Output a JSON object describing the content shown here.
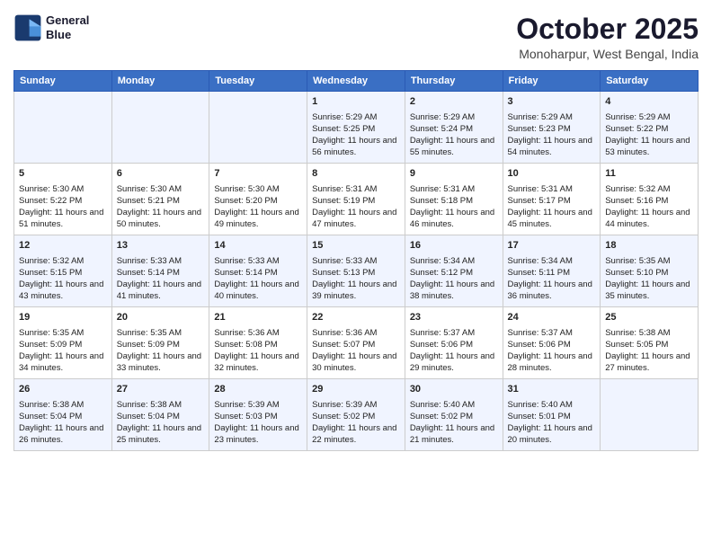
{
  "header": {
    "logo_line1": "General",
    "logo_line2": "Blue",
    "month_title": "October 2025",
    "subtitle": "Monoharpur, West Bengal, India"
  },
  "weekdays": [
    "Sunday",
    "Monday",
    "Tuesday",
    "Wednesday",
    "Thursday",
    "Friday",
    "Saturday"
  ],
  "weeks": [
    [
      {
        "day": "",
        "sunrise": "",
        "sunset": "",
        "daylight": ""
      },
      {
        "day": "",
        "sunrise": "",
        "sunset": "",
        "daylight": ""
      },
      {
        "day": "",
        "sunrise": "",
        "sunset": "",
        "daylight": ""
      },
      {
        "day": "1",
        "sunrise": "Sunrise: 5:29 AM",
        "sunset": "Sunset: 5:25 PM",
        "daylight": "Daylight: 11 hours and 56 minutes."
      },
      {
        "day": "2",
        "sunrise": "Sunrise: 5:29 AM",
        "sunset": "Sunset: 5:24 PM",
        "daylight": "Daylight: 11 hours and 55 minutes."
      },
      {
        "day": "3",
        "sunrise": "Sunrise: 5:29 AM",
        "sunset": "Sunset: 5:23 PM",
        "daylight": "Daylight: 11 hours and 54 minutes."
      },
      {
        "day": "4",
        "sunrise": "Sunrise: 5:29 AM",
        "sunset": "Sunset: 5:22 PM",
        "daylight": "Daylight: 11 hours and 53 minutes."
      }
    ],
    [
      {
        "day": "5",
        "sunrise": "Sunrise: 5:30 AM",
        "sunset": "Sunset: 5:22 PM",
        "daylight": "Daylight: 11 hours and 51 minutes."
      },
      {
        "day": "6",
        "sunrise": "Sunrise: 5:30 AM",
        "sunset": "Sunset: 5:21 PM",
        "daylight": "Daylight: 11 hours and 50 minutes."
      },
      {
        "day": "7",
        "sunrise": "Sunrise: 5:30 AM",
        "sunset": "Sunset: 5:20 PM",
        "daylight": "Daylight: 11 hours and 49 minutes."
      },
      {
        "day": "8",
        "sunrise": "Sunrise: 5:31 AM",
        "sunset": "Sunset: 5:19 PM",
        "daylight": "Daylight: 11 hours and 47 minutes."
      },
      {
        "day": "9",
        "sunrise": "Sunrise: 5:31 AM",
        "sunset": "Sunset: 5:18 PM",
        "daylight": "Daylight: 11 hours and 46 minutes."
      },
      {
        "day": "10",
        "sunrise": "Sunrise: 5:31 AM",
        "sunset": "Sunset: 5:17 PM",
        "daylight": "Daylight: 11 hours and 45 minutes."
      },
      {
        "day": "11",
        "sunrise": "Sunrise: 5:32 AM",
        "sunset": "Sunset: 5:16 PM",
        "daylight": "Daylight: 11 hours and 44 minutes."
      }
    ],
    [
      {
        "day": "12",
        "sunrise": "Sunrise: 5:32 AM",
        "sunset": "Sunset: 5:15 PM",
        "daylight": "Daylight: 11 hours and 43 minutes."
      },
      {
        "day": "13",
        "sunrise": "Sunrise: 5:33 AM",
        "sunset": "Sunset: 5:14 PM",
        "daylight": "Daylight: 11 hours and 41 minutes."
      },
      {
        "day": "14",
        "sunrise": "Sunrise: 5:33 AM",
        "sunset": "Sunset: 5:14 PM",
        "daylight": "Daylight: 11 hours and 40 minutes."
      },
      {
        "day": "15",
        "sunrise": "Sunrise: 5:33 AM",
        "sunset": "Sunset: 5:13 PM",
        "daylight": "Daylight: 11 hours and 39 minutes."
      },
      {
        "day": "16",
        "sunrise": "Sunrise: 5:34 AM",
        "sunset": "Sunset: 5:12 PM",
        "daylight": "Daylight: 11 hours and 38 minutes."
      },
      {
        "day": "17",
        "sunrise": "Sunrise: 5:34 AM",
        "sunset": "Sunset: 5:11 PM",
        "daylight": "Daylight: 11 hours and 36 minutes."
      },
      {
        "day": "18",
        "sunrise": "Sunrise: 5:35 AM",
        "sunset": "Sunset: 5:10 PM",
        "daylight": "Daylight: 11 hours and 35 minutes."
      }
    ],
    [
      {
        "day": "19",
        "sunrise": "Sunrise: 5:35 AM",
        "sunset": "Sunset: 5:09 PM",
        "daylight": "Daylight: 11 hours and 34 minutes."
      },
      {
        "day": "20",
        "sunrise": "Sunrise: 5:35 AM",
        "sunset": "Sunset: 5:09 PM",
        "daylight": "Daylight: 11 hours and 33 minutes."
      },
      {
        "day": "21",
        "sunrise": "Sunrise: 5:36 AM",
        "sunset": "Sunset: 5:08 PM",
        "daylight": "Daylight: 11 hours and 32 minutes."
      },
      {
        "day": "22",
        "sunrise": "Sunrise: 5:36 AM",
        "sunset": "Sunset: 5:07 PM",
        "daylight": "Daylight: 11 hours and 30 minutes."
      },
      {
        "day": "23",
        "sunrise": "Sunrise: 5:37 AM",
        "sunset": "Sunset: 5:06 PM",
        "daylight": "Daylight: 11 hours and 29 minutes."
      },
      {
        "day": "24",
        "sunrise": "Sunrise: 5:37 AM",
        "sunset": "Sunset: 5:06 PM",
        "daylight": "Daylight: 11 hours and 28 minutes."
      },
      {
        "day": "25",
        "sunrise": "Sunrise: 5:38 AM",
        "sunset": "Sunset: 5:05 PM",
        "daylight": "Daylight: 11 hours and 27 minutes."
      }
    ],
    [
      {
        "day": "26",
        "sunrise": "Sunrise: 5:38 AM",
        "sunset": "Sunset: 5:04 PM",
        "daylight": "Daylight: 11 hours and 26 minutes."
      },
      {
        "day": "27",
        "sunrise": "Sunrise: 5:38 AM",
        "sunset": "Sunset: 5:04 PM",
        "daylight": "Daylight: 11 hours and 25 minutes."
      },
      {
        "day": "28",
        "sunrise": "Sunrise: 5:39 AM",
        "sunset": "Sunset: 5:03 PM",
        "daylight": "Daylight: 11 hours and 23 minutes."
      },
      {
        "day": "29",
        "sunrise": "Sunrise: 5:39 AM",
        "sunset": "Sunset: 5:02 PM",
        "daylight": "Daylight: 11 hours and 22 minutes."
      },
      {
        "day": "30",
        "sunrise": "Sunrise: 5:40 AM",
        "sunset": "Sunset: 5:02 PM",
        "daylight": "Daylight: 11 hours and 21 minutes."
      },
      {
        "day": "31",
        "sunrise": "Sunrise: 5:40 AM",
        "sunset": "Sunset: 5:01 PM",
        "daylight": "Daylight: 11 hours and 20 minutes."
      },
      {
        "day": "",
        "sunrise": "",
        "sunset": "",
        "daylight": ""
      }
    ]
  ]
}
